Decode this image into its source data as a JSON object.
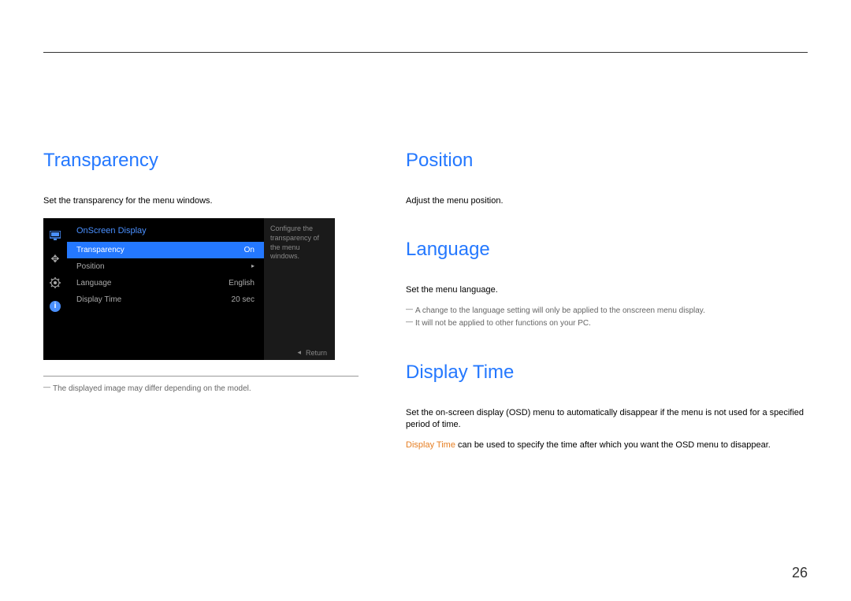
{
  "left": {
    "heading": "Transparency",
    "body": "Set the transparency for the menu windows.",
    "footnote": "The displayed image may differ depending on the model."
  },
  "osd": {
    "title": "OnScreen Display",
    "rows": [
      {
        "label": "Transparency",
        "value": "On",
        "highlighted": true
      },
      {
        "label": "Position",
        "value": "▸",
        "highlighted": false
      },
      {
        "label": "Language",
        "value": "English",
        "highlighted": false
      },
      {
        "label": "Display Time",
        "value": "20 sec",
        "highlighted": false
      }
    ],
    "desc": "Configure the transparency of the menu windows.",
    "return": "Return"
  },
  "right": {
    "position": {
      "heading": "Position",
      "body": "Adjust the menu position."
    },
    "language": {
      "heading": "Language",
      "body": "Set the menu language.",
      "note1": "A change to the language setting will only be applied to the onscreen menu display.",
      "note2": "It will not be applied to other functions on your PC."
    },
    "displayTime": {
      "heading": "Display Time",
      "body": "Set the on-screen display (OSD) menu to automatically disappear if the menu is not used for a specified period of time.",
      "highlightTerm": "Display Time",
      "body2": " can be used to specify the time after which you want the OSD menu to disappear."
    }
  },
  "pageNumber": "26"
}
